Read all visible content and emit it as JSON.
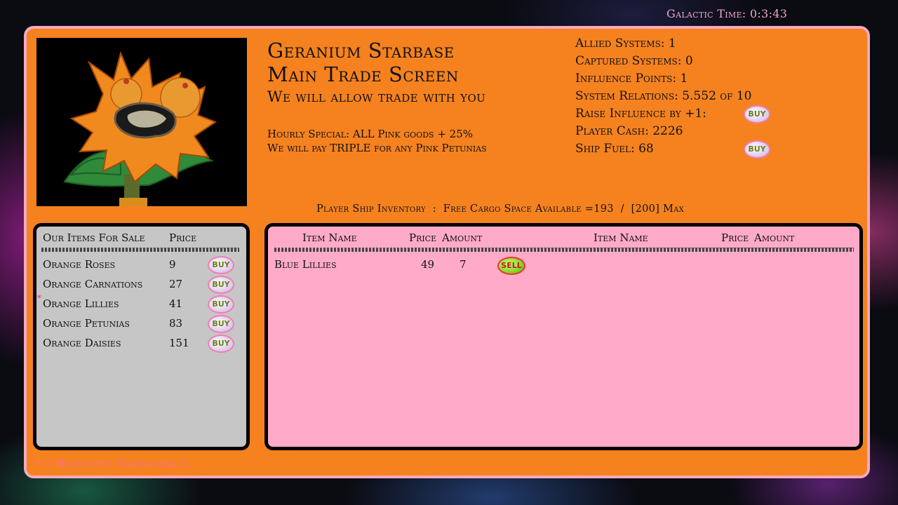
{
  "clock": {
    "label": "Galactic Time:",
    "value": "0:3:43"
  },
  "header": {
    "station_name": "Geranium Starbase",
    "screen_name": "Main Trade Screen",
    "relation_text": "We will allow trade with you",
    "special_1": "Hourly Special: ALL Pink goods + 25%",
    "special_2": "We will pay TRIPLE for any Pink Petunias"
  },
  "stats": {
    "allied": "Allied Systems: 1",
    "captured": "Captured Systems: 0",
    "influence": "Influence Points: 1",
    "relations": "System Relations: 5.552 of 10",
    "raise": "Raise Influence by +1:",
    "cash": "Player Cash: 2226",
    "fuel": "Ship Fuel: 68"
  },
  "buttons": {
    "buy": "BUY",
    "sell": "SELL"
  },
  "inventory_header": "Player Ship Inventory  :  Free Cargo Space Available =193  /  [200] Max",
  "sale": {
    "col_item": "Our Items For Sale",
    "col_price": "Price",
    "items": [
      {
        "name": "Orange Roses",
        "price": "9"
      },
      {
        "name": "Orange Carnations",
        "price": "27"
      },
      {
        "name": "Orange Lillies",
        "price": "41",
        "requested_mark": "*"
      },
      {
        "name": "Orange Petunias",
        "price": "83"
      },
      {
        "name": "Orange Daisies",
        "price": "151"
      }
    ]
  },
  "inventory": {
    "col_item": "Item Name",
    "col_price": "Price",
    "col_amount": "Amount",
    "col_item_2": "Item Name",
    "col_price_2": "Price",
    "col_amount_2": "Amount",
    "items": [
      {
        "name": "Blue Lillies",
        "price": "49",
        "amount": "7"
      }
    ]
  },
  "footer": "* = Requested Somewhere :)",
  "colors": {
    "panel": "#f5821f",
    "panel_border": "#f4a9c0",
    "sale_bg": "#c6c6c6",
    "inventory_bg": "#ffaac8"
  },
  "portrait_icon": "orange-flower-creature-icon"
}
